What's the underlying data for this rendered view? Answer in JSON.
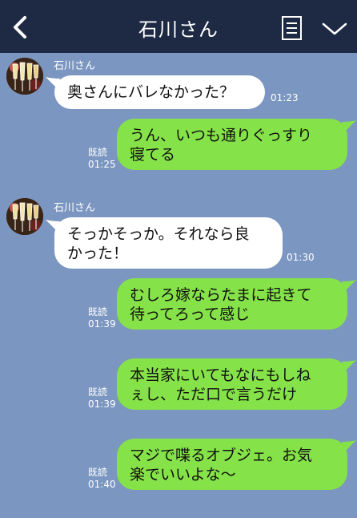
{
  "header": {
    "title": "石川さん",
    "back_icon": "chevron-left-icon",
    "note_icon": "notes-icon",
    "menu_icon": "chevron-down-icon"
  },
  "colors": {
    "header_bg": "#1e2a44",
    "chat_bg": "#7b96c0",
    "incoming_bubble": "#ffffff",
    "outgoing_bubble": "#85e249"
  },
  "messages": [
    {
      "direction": "in",
      "sender": "石川さん",
      "lines": [
        "奥さんにバレなかった？"
      ],
      "time": "01:23"
    },
    {
      "direction": "out",
      "lines": [
        "うん、いつも通りぐっすり",
        "寝てる"
      ],
      "read": "既読",
      "time": "01:25"
    },
    {
      "direction": "in",
      "sender": "石川さん",
      "lines": [
        "そっかそっか。それなら良",
        "かった！"
      ],
      "time": "01:30"
    },
    {
      "direction": "out",
      "lines": [
        "むしろ嫁ならたまに起きて",
        "待ってろって感じ"
      ],
      "read": "既読",
      "time": "01:39"
    },
    {
      "direction": "out",
      "lines": [
        "本当家にいてもなにもしね",
        "ぇし、ただ口で言うだけ"
      ],
      "read": "既読",
      "time": "01:39"
    },
    {
      "direction": "out",
      "lines": [
        "マジで喋るオブジェ。お気",
        "楽でいいよな〜"
      ],
      "read": "既読",
      "time": "01:40"
    }
  ]
}
